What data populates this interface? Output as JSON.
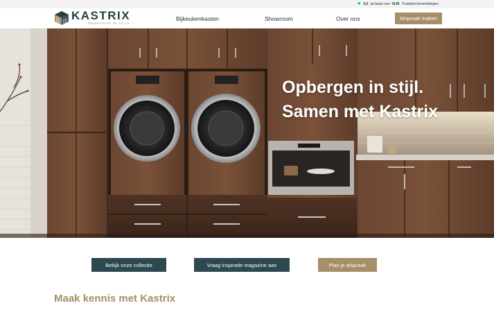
{
  "trustbar": {
    "star_icon": "star-icon",
    "rating": "4,5",
    "text_before": "op basis van",
    "count": "4145",
    "text_after": "Trustpilot beoordelingen"
  },
  "header": {
    "logo_name": "KASTRIX",
    "logo_tagline": "OPBERGEN IN STIJL",
    "nav": [
      "Bijkeukenkasten",
      "Showroom",
      "Over ons"
    ],
    "cta": "Afspraak maken"
  },
  "hero": {
    "title_line1": "Opbergen in stijl.",
    "title_line2": "Samen met Kastrix"
  },
  "actions": {
    "collection": "Bekijk onze collectie",
    "magazine": "Vraag inspiratie magazine aan",
    "appointment": "Plan je afspraak"
  },
  "intro": {
    "title": "Maak kennis met Kastrix"
  },
  "colors": {
    "brand_dark": "#2e4851",
    "brand_gold": "#a58e68",
    "trust_green": "#00b67a"
  }
}
